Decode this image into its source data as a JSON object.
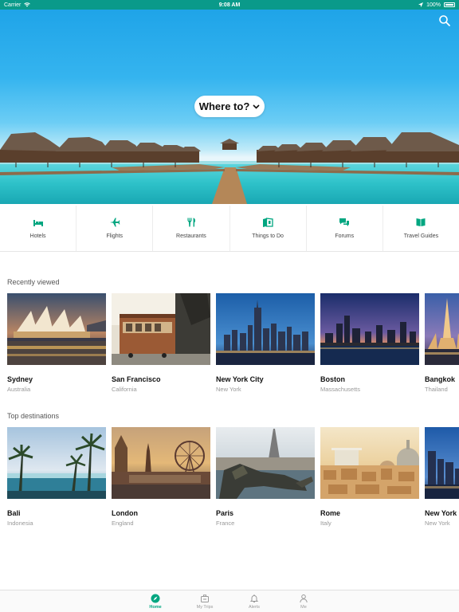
{
  "status_bar": {
    "carrier": "Carrier",
    "time": "9:08 AM",
    "battery": "100%"
  },
  "hero": {
    "where_to": "Where to?"
  },
  "categories": [
    {
      "label": "Hotels",
      "icon": "bed-icon"
    },
    {
      "label": "Flights",
      "icon": "plane-icon"
    },
    {
      "label": "Restaurants",
      "icon": "fork-knife-icon"
    },
    {
      "label": "Things to Do",
      "icon": "ticket-icon"
    },
    {
      "label": "Forums",
      "icon": "chat-bubbles-icon"
    },
    {
      "label": "Travel Guides",
      "icon": "book-icon"
    }
  ],
  "recently_viewed": {
    "title": "Recently viewed",
    "items": [
      {
        "name": "Sydney",
        "region": "Australia"
      },
      {
        "name": "San Francisco",
        "region": "California"
      },
      {
        "name": "New York City",
        "region": "New York"
      },
      {
        "name": "Boston",
        "region": "Massachusetts"
      },
      {
        "name": "Bangkok",
        "region": "Thailand"
      }
    ]
  },
  "top_destinations": {
    "title": "Top destinations",
    "items": [
      {
        "name": "Bali",
        "region": "Indonesia"
      },
      {
        "name": "London",
        "region": "England"
      },
      {
        "name": "Paris",
        "region": "France"
      },
      {
        "name": "Rome",
        "region": "Italy"
      },
      {
        "name": "New York C",
        "region": "New York"
      }
    ]
  },
  "tab_bar": [
    {
      "label": "Home",
      "active": true
    },
    {
      "label": "My Trips",
      "active": false
    },
    {
      "label": "Alerts",
      "active": false
    },
    {
      "label": "Me",
      "active": false
    }
  ],
  "colors": {
    "status_bar": "#0a9a8a",
    "accent": "#00a680"
  }
}
